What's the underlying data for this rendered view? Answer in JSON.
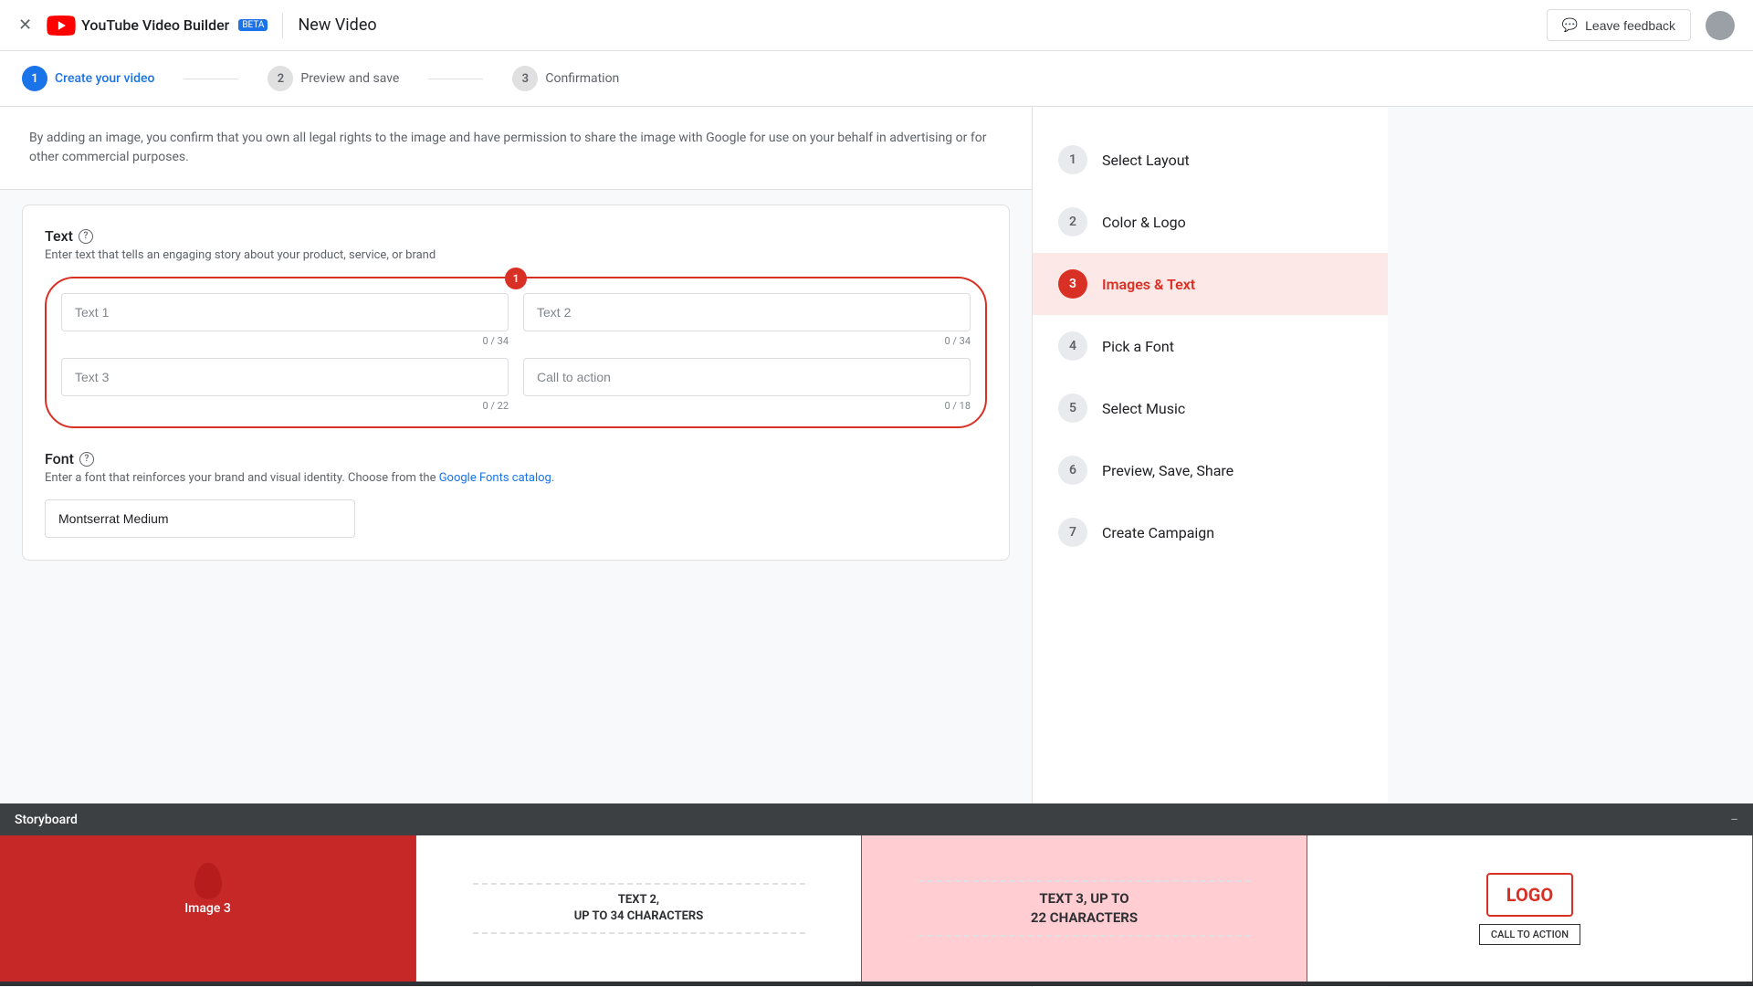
{
  "header": {
    "close_icon": "×",
    "app_name": "YouTube Video Builder",
    "beta_label": "BETA",
    "divider": "|",
    "page_title": "New Video",
    "feedback_icon": "💬",
    "feedback_label": "Leave feedback"
  },
  "stepper": {
    "steps": [
      {
        "number": "1",
        "label": "Create your video",
        "state": "active"
      },
      {
        "number": "2",
        "label": "Preview and save",
        "state": "inactive"
      },
      {
        "number": "3",
        "label": "Confirmation",
        "state": "inactive"
      }
    ]
  },
  "info_banner": {
    "text": "By adding an image, you confirm that you own all legal rights to the image and have permission to share the image with Google for use on your behalf in advertising or for other commercial purposes."
  },
  "text_section": {
    "title": "Text",
    "help_icon": "?",
    "subtitle": "Enter text that tells an engaging story about your product, service, or brand",
    "badge": "1",
    "fields": [
      {
        "placeholder": "Text 1",
        "char_count": "0 / 34"
      },
      {
        "placeholder": "Text 2",
        "char_count": "0 / 34"
      },
      {
        "placeholder": "Text 3",
        "char_count": "0 / 22"
      },
      {
        "placeholder": "Call to action",
        "char_count": "0 / 18"
      }
    ]
  },
  "font_section": {
    "title": "Font",
    "help_icon": "?",
    "subtitle_start": "Enter a font that reinforces your brand and visual identity. Choose from the ",
    "link_text": "Google Fonts catalog",
    "subtitle_end": ".",
    "font_value": "Montserrat Medium"
  },
  "sidebar": {
    "items": [
      {
        "number": "1",
        "label": "Select Layout",
        "state": "inactive"
      },
      {
        "number": "2",
        "label": "Color & Logo",
        "state": "inactive"
      },
      {
        "number": "3",
        "label": "Images & Text",
        "state": "active"
      },
      {
        "number": "4",
        "label": "Pick a Font",
        "state": "inactive"
      },
      {
        "number": "5",
        "label": "Select Music",
        "state": "inactive"
      },
      {
        "number": "6",
        "label": "Preview, Save, Share",
        "state": "inactive"
      },
      {
        "number": "7",
        "label": "Create Campaign",
        "state": "inactive"
      }
    ]
  },
  "storyboard": {
    "title": "Storyboard",
    "minimize_icon": "−",
    "frames": [
      {
        "type": "image",
        "label": "Image 3"
      },
      {
        "type": "text",
        "line1": "TEXT 2,",
        "line2": "UP TO 34 CHARACTERS"
      },
      {
        "type": "text",
        "line1": "TEXT 3, UP TO",
        "line2": "22 CHARACTERS"
      },
      {
        "type": "logo",
        "logo_text": "LOGO",
        "cta_text": "CALL TO ACTION"
      }
    ]
  }
}
